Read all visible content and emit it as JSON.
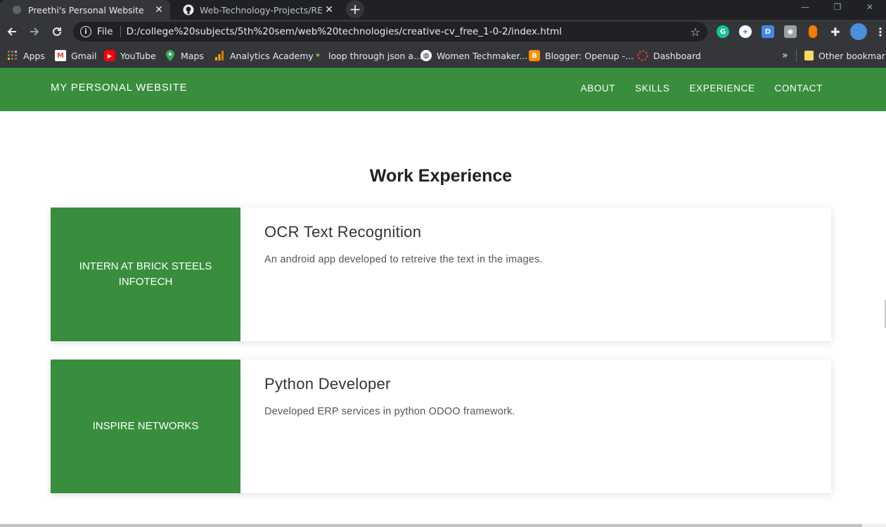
{
  "browser": {
    "tabs": [
      {
        "title": "Preethi's Personal Website",
        "close": "✕"
      },
      {
        "title": "Web-Technology-Projects/README",
        "close": "✕"
      }
    ],
    "new_tab": "+",
    "url_scheme": "File",
    "url": "D:/college%20subjects/5th%20sem/web%20technologies/creative-cv_free_1-0-2/index.html",
    "bookmarks": [
      {
        "label": "Apps"
      },
      {
        "label": "Gmail"
      },
      {
        "label": "YouTube"
      },
      {
        "label": "Maps"
      },
      {
        "label": "Analytics Academy"
      },
      {
        "label": "loop through json a..."
      },
      {
        "label": "Women Techmaker..."
      },
      {
        "label": "Blogger: Openup -..."
      },
      {
        "label": "Dashboard"
      }
    ],
    "overflow": "»",
    "other_bookmarks": "Other bookmarks"
  },
  "site": {
    "brand": "MY PERSONAL WEBSITE",
    "nav": [
      "ABOUT",
      "SKILLS",
      "EXPERIENCE",
      "CONTACT"
    ],
    "section_title": "Work Experience",
    "experience": [
      {
        "company": "INTERN AT BRICK STEELS INFOTECH",
        "role": "OCR Text Recognition",
        "description": "An android app developed to retreive the text in the images."
      },
      {
        "company": "INSPIRE NETWORKS",
        "role": "Python Developer",
        "description": "Developed ERP services in python ODOO framework."
      }
    ]
  },
  "colors": {
    "accent_green": "#388e3c",
    "chrome_dark": "#202124",
    "chrome_toolbar": "#35363a"
  }
}
